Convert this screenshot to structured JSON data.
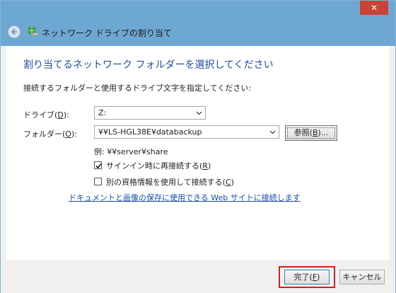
{
  "window": {
    "close_label": "✕"
  },
  "header": {
    "title": "ネットワーク ドライブの割り当て"
  },
  "content": {
    "heading": "割り当てるネットワーク フォルダーを選択してください",
    "instruction": "接続するフォルダーと使用するドライブ文字を指定してください:",
    "drive_label_pre": "ドライブ(",
    "drive_label_key": "D",
    "drive_label_post": "):",
    "drive_value": "Z:",
    "folder_label_pre": "フォルダー(",
    "folder_label_key": "O",
    "folder_label_post": "):",
    "folder_value": "¥¥LS-HGL38E¥databackup",
    "browse_pre": "参照(",
    "browse_key": "B",
    "browse_post": ")...",
    "example": "例: ¥¥server¥share",
    "reconnect_pre": "サインイン時に再接続する(",
    "reconnect_key": "R",
    "reconnect_post": ")",
    "reconnect_checked": true,
    "other_creds_pre": "別の資格情報を使用して接続する(",
    "other_creds_key": "C",
    "other_creds_post": ")",
    "other_creds_checked": false,
    "link": "ドキュメントと画像の保存に使用できる Web サイトに接続します"
  },
  "footer": {
    "finish_pre": "完了(",
    "finish_key": "F",
    "finish_post": ")",
    "cancel_label": "キャンセル"
  },
  "colors": {
    "title_bar": "#6ea8d2",
    "close": "#c74436",
    "heading": "#1f4ea0",
    "link": "#1a4ea8",
    "highlight": "#d81e1e"
  }
}
